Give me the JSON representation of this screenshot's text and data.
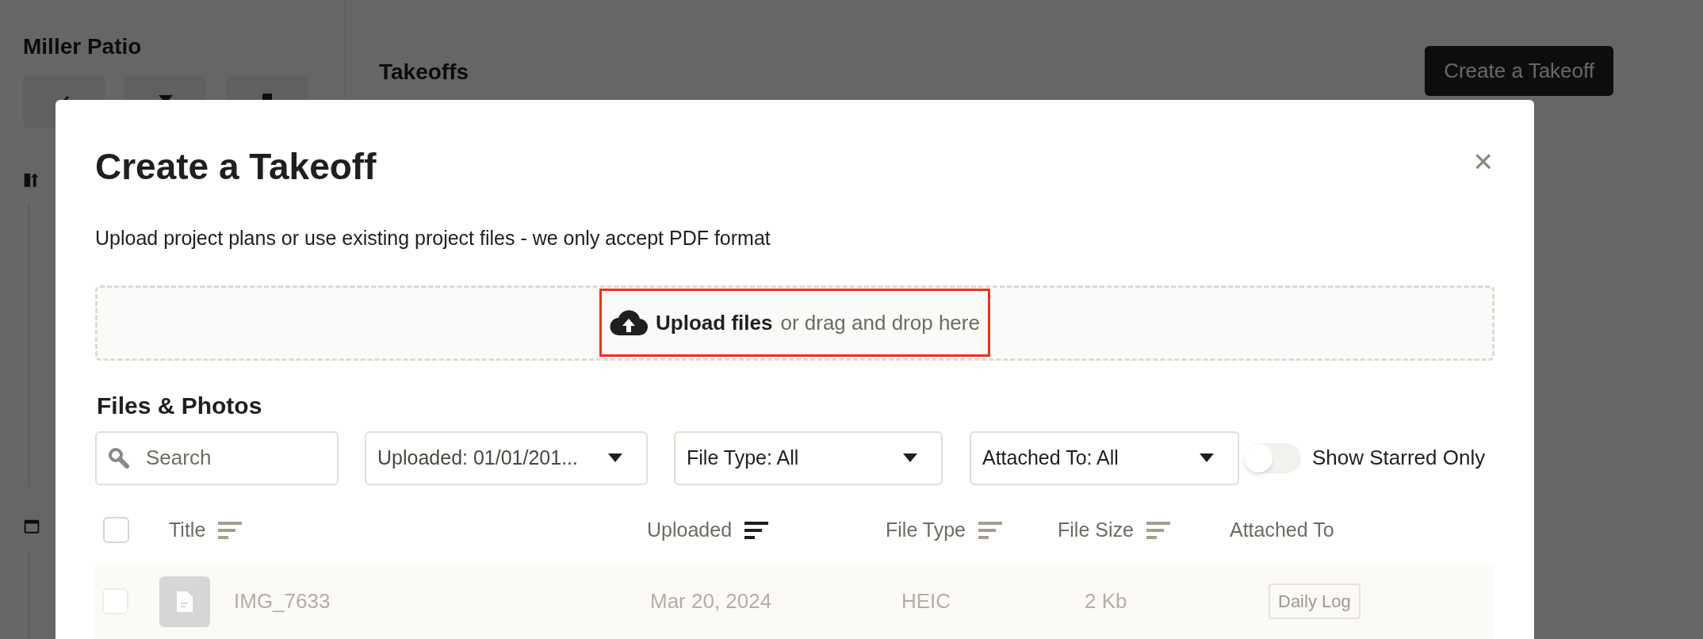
{
  "project": {
    "title": "Miller Patio"
  },
  "page": {
    "title": "Takeoffs",
    "action": "Create a Takeoff"
  },
  "modal": {
    "title": "Create a Takeoff",
    "close": "×",
    "description": "Upload project plans or use existing project files - we only accept PDF format",
    "upload": {
      "label": "Upload files",
      "hint": "or drag and drop here",
      "highlighted": true
    },
    "section_title": "Files & Photos",
    "search": {
      "placeholder": "Search"
    },
    "filters": [
      {
        "label": "Uploaded: 01/01/201..."
      },
      {
        "label": "File Type: All"
      },
      {
        "label": "Attached To: All"
      }
    ],
    "starred_toggle": {
      "label": "Show Starred Only",
      "on": false
    },
    "table": {
      "select_all": {
        "checked": false
      },
      "columns": [
        {
          "kind": "sortable",
          "label": "Title",
          "sorted": false
        },
        {
          "kind": "sortable",
          "label": "Uploaded",
          "sorted": true
        },
        {
          "kind": "sortable",
          "label": "File Type",
          "sorted": false
        },
        {
          "kind": "sortable",
          "label": "File Size",
          "sorted": false
        },
        {
          "kind": "plain",
          "label": "Attached To"
        }
      ],
      "rows": [
        {
          "title": "IMG_7633",
          "uploaded": "Mar 20, 2024",
          "file_type": "HEIC",
          "file_size": "2 Kb",
          "attached_to": "Daily Log",
          "checked": false,
          "disabled": true
        }
      ]
    }
  }
}
